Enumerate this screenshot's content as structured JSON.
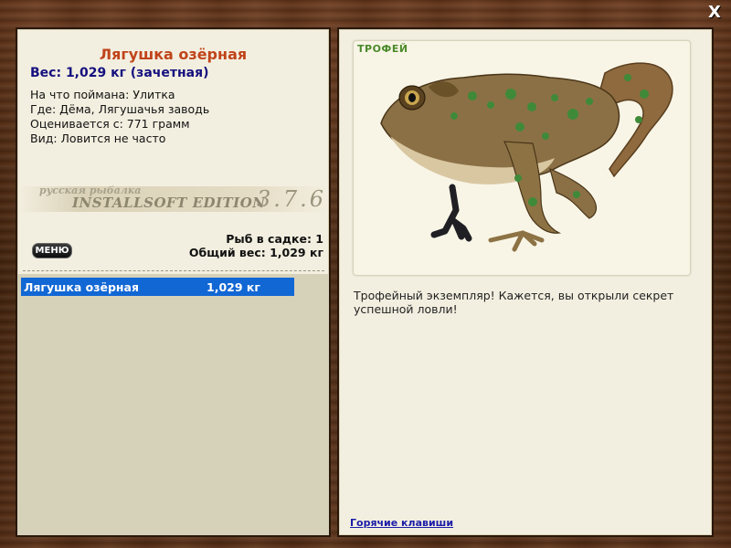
{
  "window": {
    "close_label": "X"
  },
  "catch": {
    "title": "Лягушка озёрная",
    "weight_line": "Вес: 1,029 кг (зачетная)",
    "bait_line": "На что поймана: Улитка",
    "place_line": "Где: Дёма, Лягушачья заводь",
    "rated_line": "Оценивается с: 771 грамм",
    "kind_line": "Вид: Ловится не часто"
  },
  "logo": {
    "small_text": "русская рыбалка",
    "edition_text": "INSTALLSOFT EDITION",
    "version_text": "3.7.6"
  },
  "menu": {
    "label": "МЕНЮ"
  },
  "keepnet": {
    "count_line": "Рыб в садке: 1",
    "total_line": "Общий вес: 1,029 кг",
    "rows": [
      {
        "name": "Лягушка озёрная",
        "weight": "1,029 кг"
      }
    ]
  },
  "trophy": {
    "badge": "ТРОФЕЙ",
    "image_subject": "frog",
    "description": "Трофейный экземпляр! Кажется, вы открыли секрет успешной ловли!",
    "hotkeys_link": "Горячие клавиши"
  },
  "colors": {
    "title": "#c0441a",
    "weight": "#15107e",
    "selection": "#1167d4",
    "trophy_badge": "#4a8a2a",
    "link": "#1c1ca8"
  }
}
